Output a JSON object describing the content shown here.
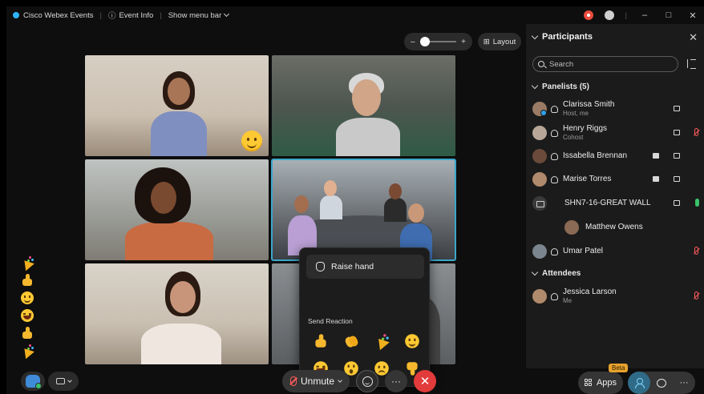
{
  "titlebar": {
    "app_name": "Cisco Webex Events",
    "event_info": "Event Info",
    "show_menu_bar": "Show menu bar",
    "minimize": "–",
    "maximize": "□",
    "close": "✕"
  },
  "stage": {
    "zoom_minus": "–",
    "zoom_plus": "+",
    "layout_label": "Layout"
  },
  "popover": {
    "raise_hand": "Raise hand",
    "send_reaction": "Send Reaction",
    "reactions": [
      "thumbs-up",
      "clap",
      "party",
      "smile",
      "laugh",
      "wow",
      "sad",
      "thumbs-down"
    ]
  },
  "reaction_rail": [
    "party",
    "thumbs-up",
    "smile",
    "laugh",
    "thumbs-up",
    "party"
  ],
  "controls": {
    "unmute_label": "Unmute",
    "more": "···",
    "end": "✕",
    "apps_label": "Apps",
    "beta": "Beta",
    "right_more": "···"
  },
  "participants_panel": {
    "title": "Participants",
    "close": "✕",
    "search_placeholder": "Search",
    "panelists_header": "Panelists (5)",
    "attendees_header": "Attendees",
    "panelists": [
      {
        "name": "Clarissa Smith",
        "role": "Host, me",
        "camera": true,
        "share": false,
        "mic": "none"
      },
      {
        "name": "Henry Riggs",
        "role": "Cohost",
        "camera": true,
        "share": false,
        "mic": "muted"
      },
      {
        "name": "Issabella Brennan",
        "role": "",
        "camera": true,
        "share": true,
        "mic": "none"
      },
      {
        "name": "Marise Torres",
        "role": "",
        "camera": true,
        "share": true,
        "mic": "none"
      },
      {
        "name": "SHN7-16-GREAT WALL",
        "role": "",
        "camera": true,
        "share": false,
        "mic": "active"
      },
      {
        "name": "Matthew Owens",
        "role": "",
        "camera": false,
        "share": false,
        "mic": "none"
      },
      {
        "name": "Umar Patel",
        "role": "",
        "camera": false,
        "share": false,
        "mic": "muted"
      }
    ],
    "attendees": [
      {
        "name": "Jessica Larson",
        "role": "Me",
        "mic": "muted"
      }
    ]
  },
  "colors": {
    "accent": "#3aa7c9",
    "end_call": "#e23b3b",
    "muted": "#ff5a5a",
    "active_mic": "#3ac36a",
    "beta": "#e8a22e"
  }
}
